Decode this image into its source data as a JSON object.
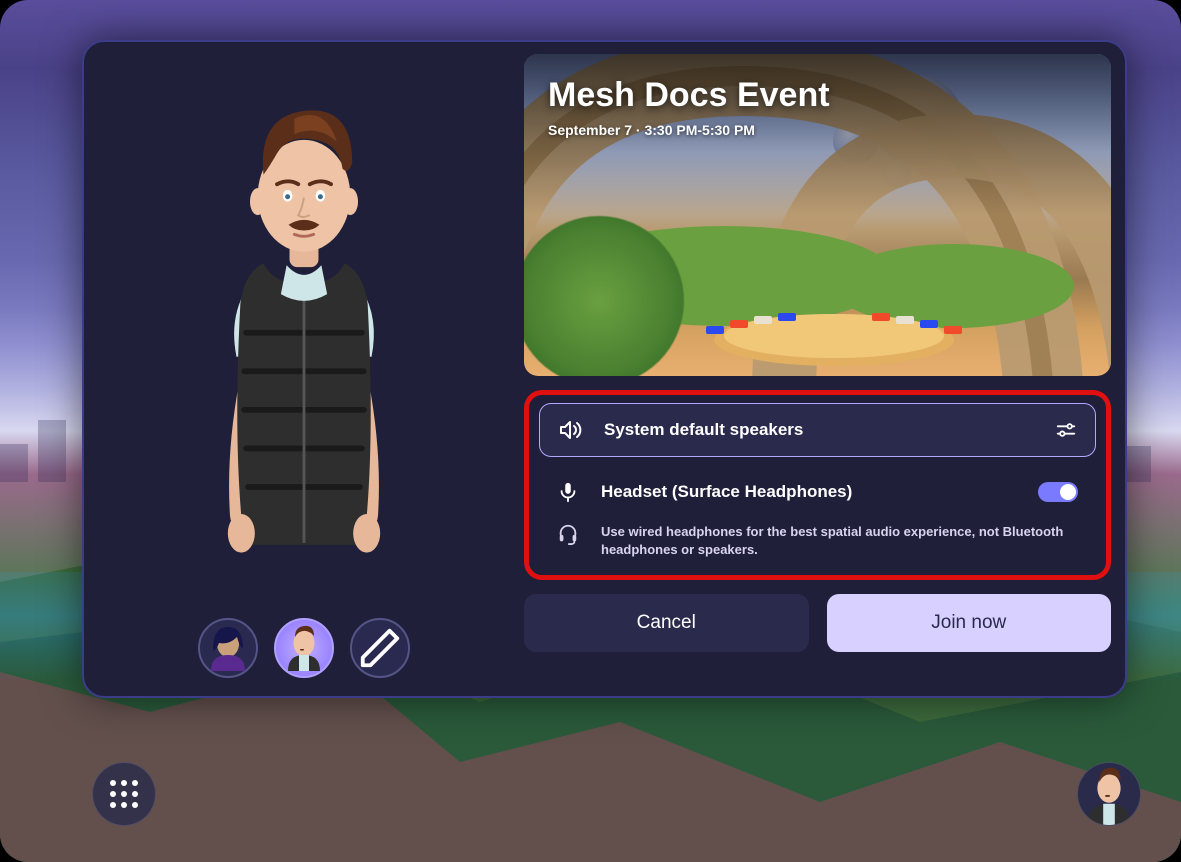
{
  "hero": {
    "title": "Mesh Docs Event",
    "subtitle": "September 7 · 3:30 PM-5:30 PM"
  },
  "audio": {
    "speakers_label": "System default speakers",
    "mic_label": "Headset (Surface Headphones)",
    "hint": "Use wired headphones for the best spatial audio experience, not Bluetooth headphones or speakers."
  },
  "buttons": {
    "cancel": "Cancel",
    "join": "Join now"
  }
}
